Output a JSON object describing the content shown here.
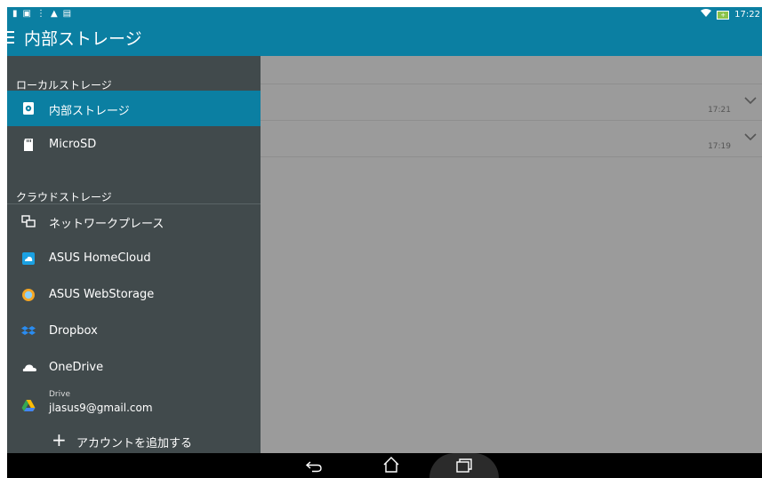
{
  "status_bar": {
    "time": "17:22",
    "colors": {
      "bar": "#0b7fa2",
      "battery": "#8bc34a"
    }
  },
  "app_bar": {
    "title": "内部ストレージ",
    "menu_icon": "hamburger-menu-icon"
  },
  "drawer": {
    "local_section": {
      "header": "ローカルストレージ",
      "items": [
        {
          "label": "内部ストレージ",
          "icon": "internal-storage-icon",
          "selected": true
        },
        {
          "label": "MicroSD",
          "icon": "sd-card-icon",
          "selected": false
        }
      ]
    },
    "cloud_section": {
      "header": "クラウドストレージ",
      "items": [
        {
          "label": "ネットワークプレース",
          "icon": "network-place-icon"
        },
        {
          "label": "ASUS HomeCloud",
          "icon": "homecloud-icon"
        },
        {
          "label": "ASUS WebStorage",
          "icon": "webstorage-icon"
        },
        {
          "label": "Dropbox",
          "icon": "dropbox-icon"
        },
        {
          "label": "OneDrive",
          "icon": "onedrive-icon"
        },
        {
          "sublabel": "Drive",
          "label": "jlasus9@gmail.com",
          "icon": "google-drive-icon"
        }
      ],
      "add_account": "アカウントを追加する"
    }
  },
  "content": {
    "rows": [
      {
        "time": "17:21"
      },
      {
        "time": "17:19"
      }
    ]
  },
  "navbar": {
    "buttons": [
      "back-icon",
      "home-icon",
      "recent-apps-icon"
    ]
  }
}
